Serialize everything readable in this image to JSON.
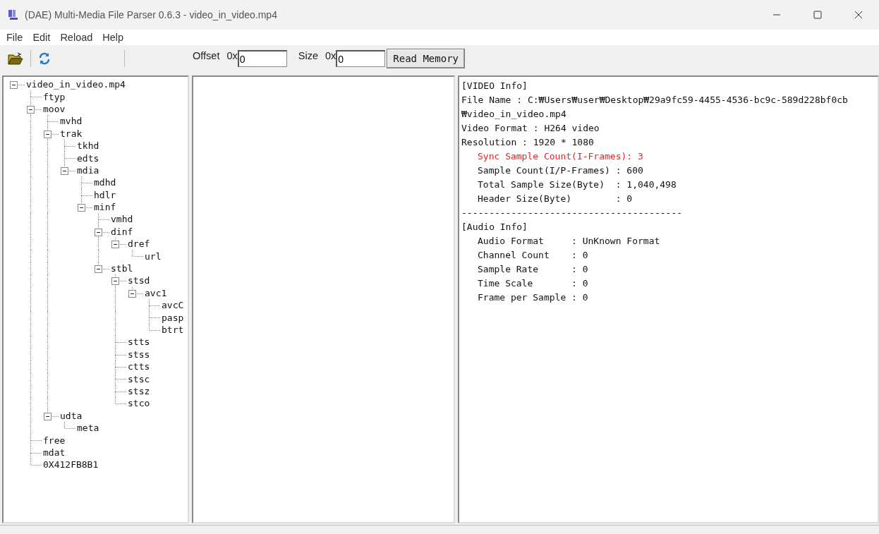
{
  "window": {
    "title": "(DAE) Multi-Media File Parser 0.6.3 - video_in_video.mp4"
  },
  "menu": [
    "File",
    "Edit",
    "Reload",
    "Help"
  ],
  "toolbar": {
    "offset_label": "Offset",
    "offset_prefix": "0x",
    "offset_value": "0",
    "size_label": "Size",
    "size_prefix": "0x",
    "size_value": "0",
    "read_button": "Read Memory"
  },
  "tree": {
    "label": "video_in_video.mp4",
    "expanded": true,
    "children": [
      {
        "label": "ftyp"
      },
      {
        "label": "moov",
        "expanded": true,
        "children": [
          {
            "label": "mvhd"
          },
          {
            "label": "trak",
            "expanded": true,
            "children": [
              {
                "label": "tkhd"
              },
              {
                "label": "edts"
              },
              {
                "label": "mdia",
                "expanded": true,
                "children": [
                  {
                    "label": "mdhd"
                  },
                  {
                    "label": "hdlr"
                  },
                  {
                    "label": "minf",
                    "expanded": true,
                    "children": [
                      {
                        "label": "vmhd"
                      },
                      {
                        "label": "dinf",
                        "expanded": true,
                        "children": [
                          {
                            "label": "dref",
                            "expanded": true,
                            "children": [
                              {
                                "label": "url"
                              }
                            ]
                          }
                        ]
                      },
                      {
                        "label": "stbl",
                        "expanded": true,
                        "children": [
                          {
                            "label": "stsd",
                            "expanded": true,
                            "children": [
                              {
                                "label": "avc1",
                                "expanded": true,
                                "children": [
                                  {
                                    "label": "avcC"
                                  },
                                  {
                                    "label": "pasp"
                                  },
                                  {
                                    "label": "btrt"
                                  }
                                ]
                              }
                            ]
                          },
                          {
                            "label": "stts"
                          },
                          {
                            "label": "stss"
                          },
                          {
                            "label": "ctts"
                          },
                          {
                            "label": "stsc"
                          },
                          {
                            "label": "stsz"
                          },
                          {
                            "label": "stco"
                          }
                        ]
                      }
                    ]
                  }
                ]
              }
            ]
          },
          {
            "label": "udta",
            "expanded": true,
            "children": [
              {
                "label": "meta"
              }
            ]
          }
        ]
      },
      {
        "label": "free"
      },
      {
        "label": "mdat"
      },
      {
        "label": "0X412FB8B1"
      }
    ]
  },
  "info": [
    {
      "kind": "plain",
      "text": "[VIDEO Info]"
    },
    {
      "kind": "plain",
      "text": "File Name : C:₩Users₩user₩Desktop₩29a9fc59-4455-4536-bc9c-589d228bf0cb"
    },
    {
      "kind": "plain",
      "text": "₩video_in_video.mp4"
    },
    {
      "kind": "plain",
      "text": "Video Format : H264 video"
    },
    {
      "kind": "plain",
      "text": "Resolution : 1920 * 1080"
    },
    {
      "kind": "alert",
      "text": "Sync Sample Count(I-Frames): 3"
    },
    {
      "kind": "entry",
      "text": "Sample Count(I/P-Frames) : 600"
    },
    {
      "kind": "entry",
      "text": "Total Sample Size(Byte)  : 1,040,498"
    },
    {
      "kind": "entry",
      "text": "Header Size(Byte)        : 0"
    },
    {
      "kind": "plain",
      "text": "----------------------------------------"
    },
    {
      "kind": "plain",
      "text": "[Audio Info]"
    },
    {
      "kind": "entry",
      "text": "Audio Format     : UnKnown Format"
    },
    {
      "kind": "entry",
      "text": "Channel Count    : 0"
    },
    {
      "kind": "entry",
      "text": "Sample Rate      : 0"
    },
    {
      "kind": "entry",
      "text": "Time Scale       : 0"
    },
    {
      "kind": "entry",
      "text": "Frame per Sample : 0"
    }
  ]
}
